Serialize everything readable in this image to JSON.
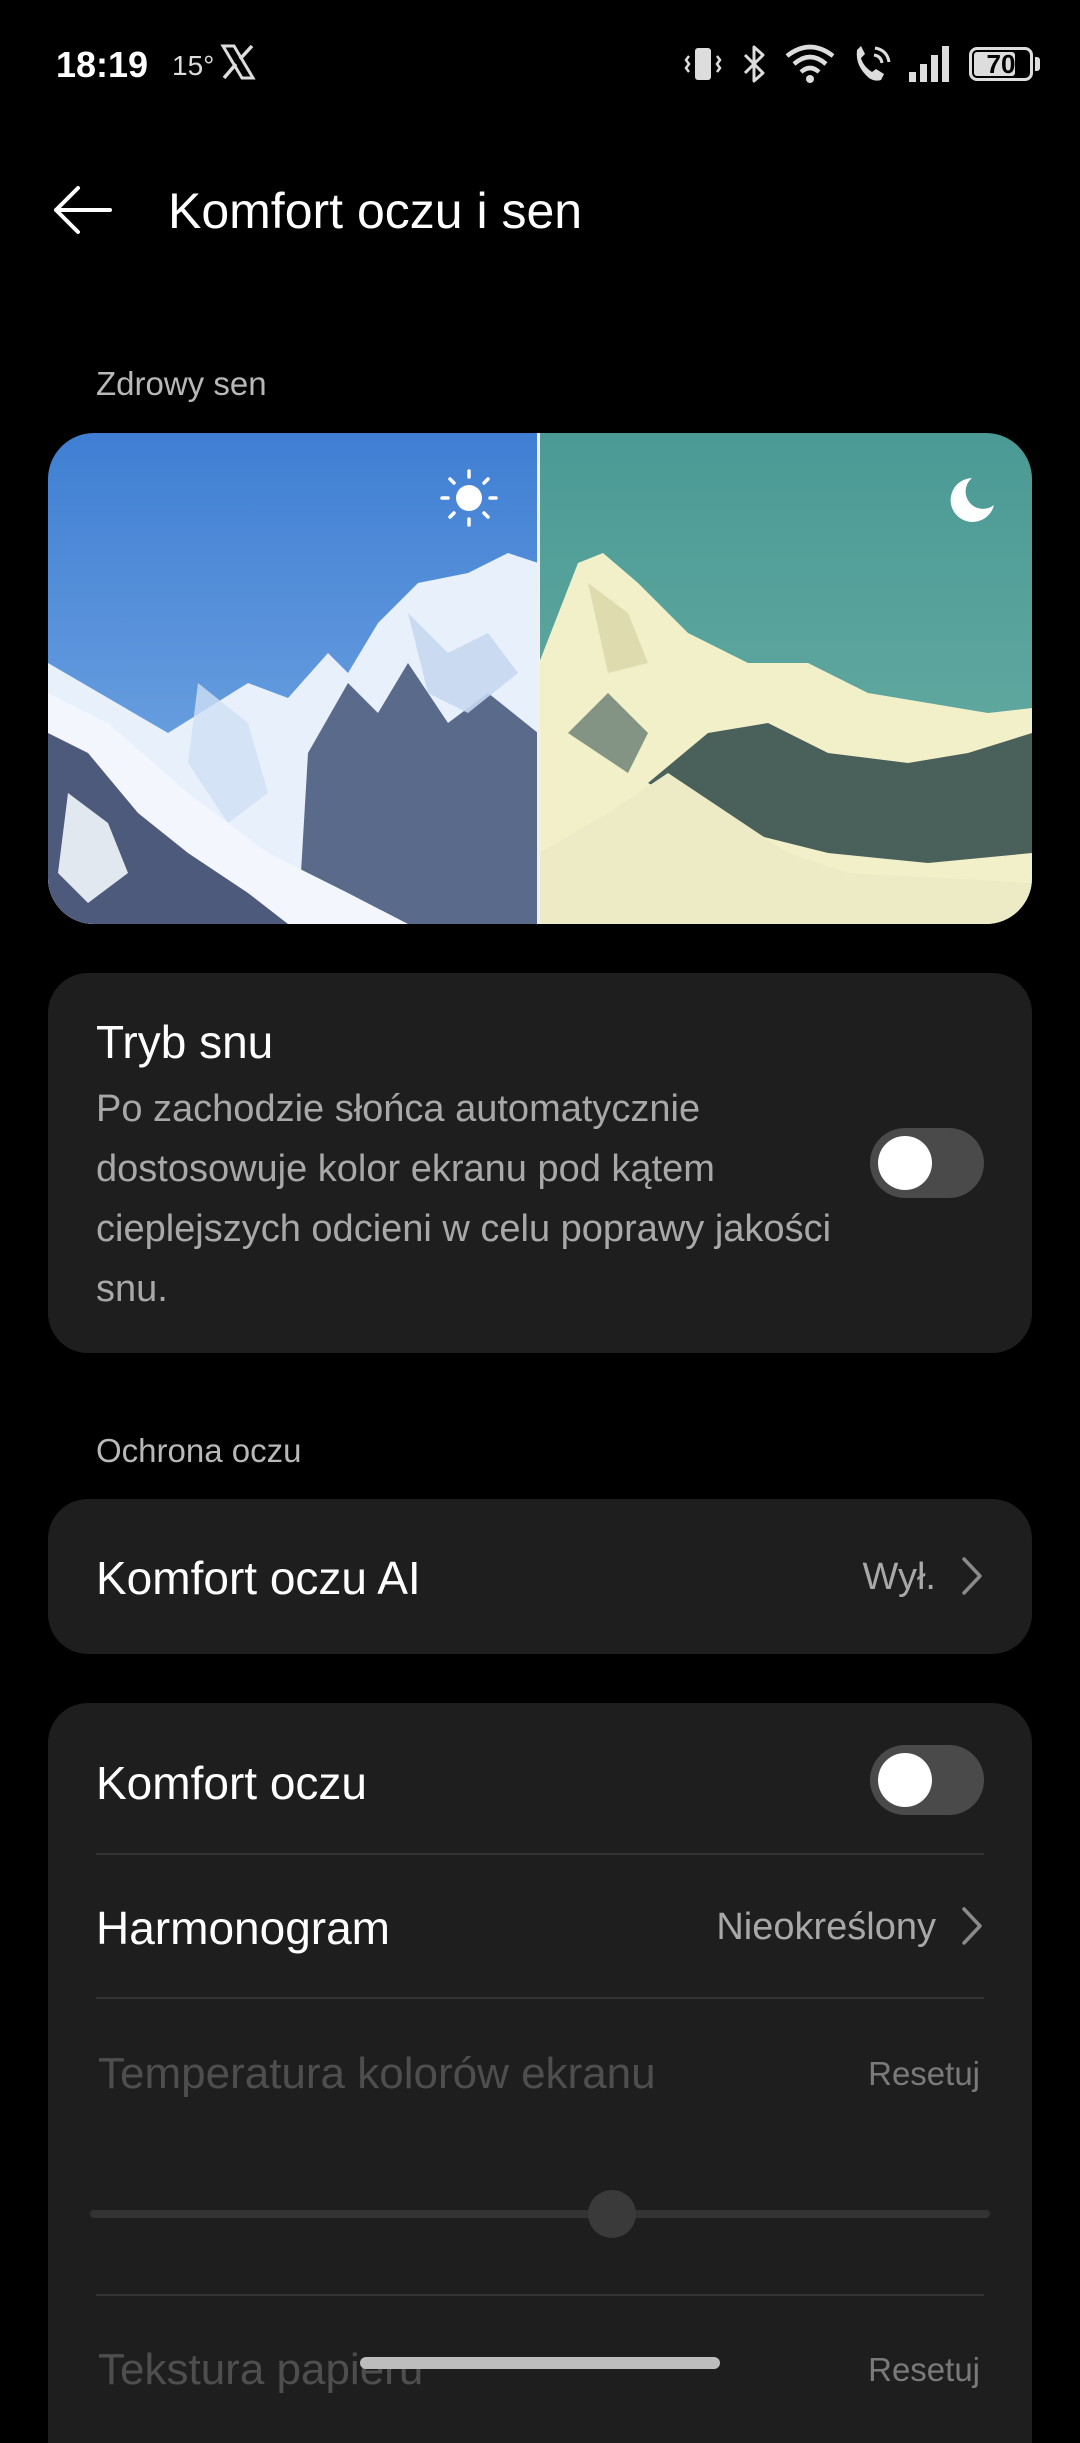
{
  "status_bar": {
    "time": "18:19",
    "temperature": "15°",
    "battery": "70",
    "icons": [
      "x-logo-icon",
      "vibrate-icon",
      "bluetooth-icon",
      "wifi-icon",
      "wifi-call-icon",
      "signal-icon",
      "battery-icon"
    ]
  },
  "header": {
    "title": "Komfort oczu i sen"
  },
  "sections": {
    "healthy_sleep": "Zdrowy sen",
    "eye_protection": "Ochrona oczu"
  },
  "sleep_mode": {
    "title": "Tryb snu",
    "description": "Po zachodzie słońca automatycznie dostosowuje kolor ekranu pod kątem cieplejszych odcieni w celu poprawy jakości snu.",
    "enabled": false
  },
  "ai_eye_comfort": {
    "title": "Komfort oczu AI",
    "value": "Wył."
  },
  "eye_comfort": {
    "title": "Komfort oczu",
    "enabled": false
  },
  "schedule": {
    "title": "Harmonogram",
    "value": "Nieokreślony"
  },
  "color_temperature": {
    "title": "Temperatura kolorów ekranu",
    "reset_label": "Resetuj",
    "level": 0.58
  },
  "paper_texture": {
    "title": "Tekstura papieru",
    "reset_label": "Resetuj"
  },
  "colors": {
    "background": "#000000",
    "card": "#1e1e1e",
    "secondary_text": "#a8a8a8",
    "disabled_text": "#4e4e4e"
  }
}
